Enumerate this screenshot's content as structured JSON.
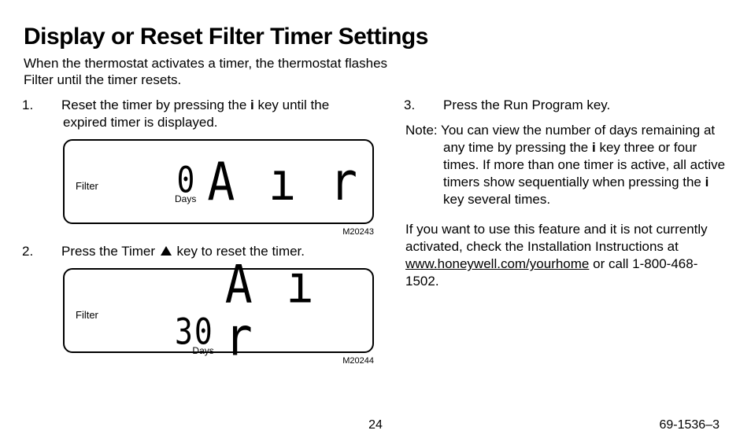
{
  "title": "Display or Reset Filter Timer Settings",
  "intro": "When the thermostat activates a timer, the thermostat flashes Filter until the timer resets.",
  "col1": {
    "step1_num": "1.",
    "step1_a": "Reset the timer by pressing the ",
    "step1_key": "i",
    "step1_b": " key until the expired timer is displayed.",
    "lcd1": {
      "filter": "Filter",
      "value": "0",
      "days": "Days",
      "air": "A ı r",
      "code": "M20243"
    },
    "step2_num": "2.",
    "step2_a": "Press the Timer ",
    "step2_b": " key to reset the timer.",
    "lcd2": {
      "filter": "Filter",
      "value": "30",
      "days": "Days",
      "air": "A ı r",
      "code": "M20244"
    }
  },
  "col2": {
    "step3_num": "3.",
    "step3": "Press the Run Program key.",
    "note_label": "Note:",
    "note_a": " You can view the number of days remaining at any time by pressing the ",
    "note_key1": "i",
    "note_b": " key three or four times. If more than one timer is active, all active timers show sequentially when pressing the ",
    "note_key2": "i",
    "note_c": " key several times.",
    "para_a": "If you want to use this feature and it is not currently activated, check the Installation Instructions at ",
    "para_link": "www.honeywell.com/yourhome",
    "para_b": " or call 1-800-468-1502."
  },
  "footer": {
    "page": "24",
    "doc": "69-1536–3"
  }
}
